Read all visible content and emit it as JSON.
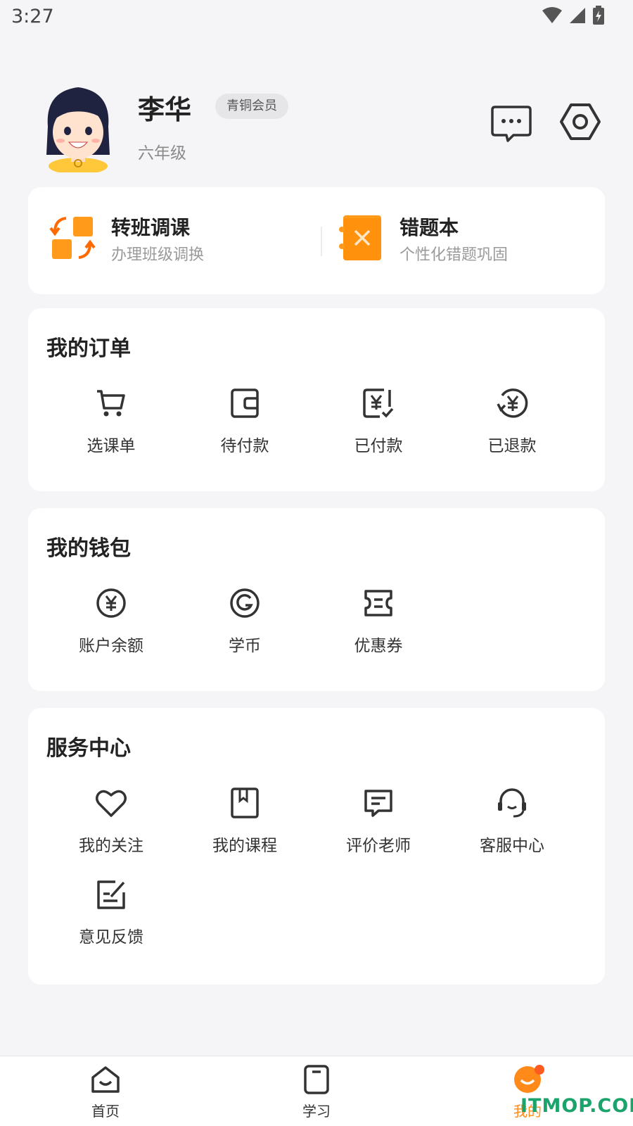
{
  "status_bar": {
    "time": "3:27"
  },
  "profile": {
    "name": "李华",
    "badge": "青铜会员",
    "grade": "六年级"
  },
  "quick_actions": [
    {
      "title": "转班调课",
      "subtitle": "办理班级调换",
      "icon": "class-transfer-icon"
    },
    {
      "title": "错题本",
      "subtitle": "个性化错题巩固",
      "icon": "mistake-book-icon"
    }
  ],
  "orders": {
    "title": "我的订单",
    "items": [
      {
        "label": "选课单",
        "icon": "cart-icon"
      },
      {
        "label": "待付款",
        "icon": "wallet-icon"
      },
      {
        "label": "已付款",
        "icon": "paid-icon"
      },
      {
        "label": "已退款",
        "icon": "refund-icon"
      }
    ]
  },
  "wallet": {
    "title": "我的钱包",
    "items": [
      {
        "label": "账户余额",
        "icon": "yuan-coin-icon"
      },
      {
        "label": "学币",
        "icon": "study-coin-icon"
      },
      {
        "label": "优惠券",
        "icon": "coupon-icon"
      }
    ]
  },
  "service": {
    "title": "服务中心",
    "items": [
      {
        "label": "我的关注",
        "icon": "heart-icon"
      },
      {
        "label": "我的课程",
        "icon": "bookmark-book-icon"
      },
      {
        "label": "评价老师",
        "icon": "comment-icon"
      },
      {
        "label": "客服中心",
        "icon": "headset-icon"
      },
      {
        "label": "意见反馈",
        "icon": "feedback-edit-icon"
      }
    ]
  },
  "tabs": [
    {
      "label": "首页",
      "icon": "home-icon"
    },
    {
      "label": "学习",
      "icon": "study-icon"
    },
    {
      "label": "我的",
      "icon": "me-icon",
      "active": true
    }
  ],
  "watermark": "ITMOP.COM",
  "colors": {
    "accent": "#ff8a1a",
    "background": "#f5f5f7",
    "card": "#ffffff"
  }
}
